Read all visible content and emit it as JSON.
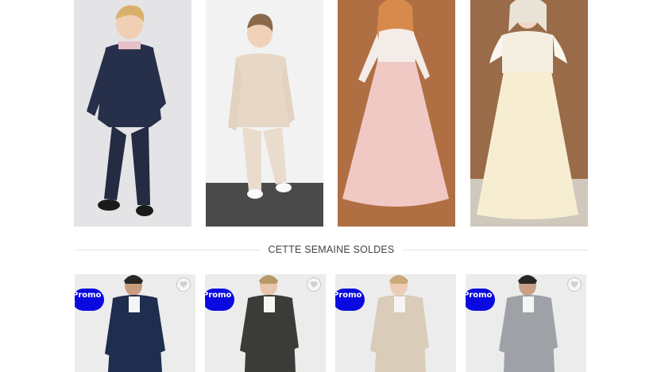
{
  "top_images": [
    {
      "name": "boy-navy-suit"
    },
    {
      "name": "boy-beige-suit"
    },
    {
      "name": "girl-pink-dress"
    },
    {
      "name": "girl-ivory-dress"
    }
  ],
  "section": {
    "title": "CETTE SEMAINE SOLDES"
  },
  "products": [
    {
      "badge": "Promo !",
      "suit_color": "#1f2d4f"
    },
    {
      "badge": "Promo !",
      "suit_color": "#3b3b38"
    },
    {
      "badge": "Promo !",
      "suit_color": "#d9ccb8"
    },
    {
      "badge": "Promo !",
      "suit_color": "#9ea2a6"
    }
  ],
  "icons": {
    "wishlist": "heart-icon"
  }
}
